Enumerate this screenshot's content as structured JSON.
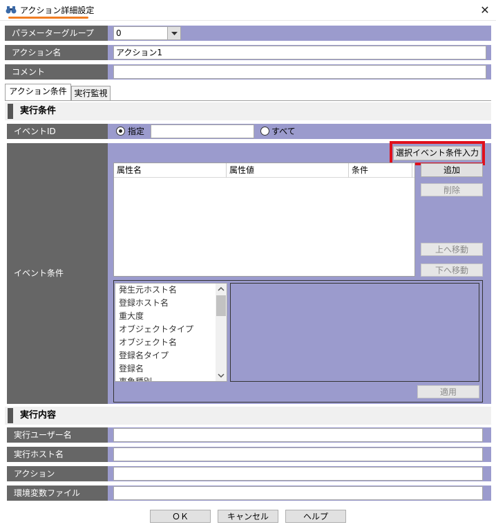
{
  "window": {
    "title": "アクション詳細設定",
    "close_glyph": "✕",
    "icon": "binoculars-icon"
  },
  "form": {
    "param_group_label": "パラメーターグループ",
    "param_group_value": "0",
    "action_name_label": "アクション名",
    "action_name_value": "アクション1",
    "comment_label": "コメント",
    "comment_value": ""
  },
  "tabs": [
    {
      "label": "アクション条件"
    },
    {
      "label": "実行監視"
    }
  ],
  "exec_conditions": {
    "title": "実行条件",
    "event_id_label": "イベントID",
    "radio_specify": "指定",
    "radio_all": "すべて",
    "event_cond_label": "イベント条件",
    "select_event_button": "選択イベント条件入力",
    "table_headers": [
      "属性名",
      "属性値",
      "条件"
    ],
    "buttons": {
      "add": "追加",
      "delete": "削除",
      "move_up": "上へ移動",
      "move_down": "下へ移動",
      "apply": "適用"
    },
    "attr_list": [
      "発生元ホスト名",
      "登録ホスト名",
      "重大度",
      "オブジェクトタイプ",
      "オブジェクト名",
      "登録名タイプ",
      "登録名",
      "事象種別"
    ]
  },
  "exec_content": {
    "title": "実行内容",
    "user_label": "実行ユーザー名",
    "host_label": "実行ホスト名",
    "action_label": "アクション",
    "env_label": "環境変数ファイル"
  },
  "footer": {
    "ok": "ＯＫ",
    "cancel": "キャンセル",
    "help": "ヘルプ"
  },
  "colors": {
    "label_bg": "#666666",
    "panel_bg": "#9b9bcd",
    "highlight": "#e0101c",
    "accent_underline": "#f07d22"
  }
}
